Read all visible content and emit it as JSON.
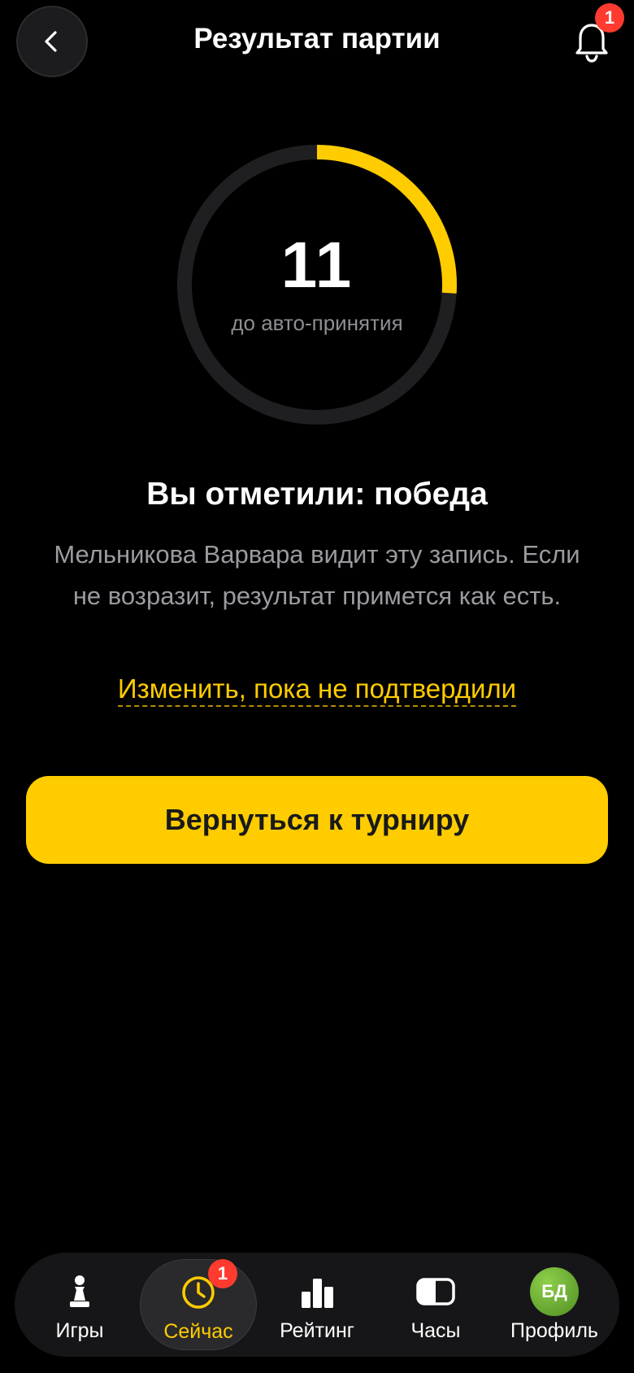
{
  "header": {
    "title": "Результат партии",
    "notification_count": "1"
  },
  "timer": {
    "seconds": "11",
    "caption": "до авто-принятия",
    "progress": 0.26,
    "colors": {
      "track": "#1f1f21",
      "fill": "#ffcc00"
    }
  },
  "result": {
    "title": "Вы отметили: победа",
    "description": "Мельникова Варвара видит эту запись. Если не возразит, результат примется как есть.",
    "change_link": "Изменить, пока не подтвердили"
  },
  "primary_button": {
    "label": "Вернуться к турниру"
  },
  "tabbar": {
    "tabs": [
      {
        "label": "Игры",
        "icon": "pawn-icon"
      },
      {
        "label": "Сейчас",
        "icon": "clock-icon",
        "badge": "1",
        "active": true
      },
      {
        "label": "Рейтинг",
        "icon": "bar-chart-icon"
      },
      {
        "label": "Часы",
        "icon": "chess-clock-icon"
      },
      {
        "label": "Профиль",
        "icon": "avatar",
        "avatar_initials": "БД"
      }
    ]
  },
  "colors": {
    "accent": "#ffcc00",
    "badge": "#ff3b30",
    "background": "#000000"
  }
}
